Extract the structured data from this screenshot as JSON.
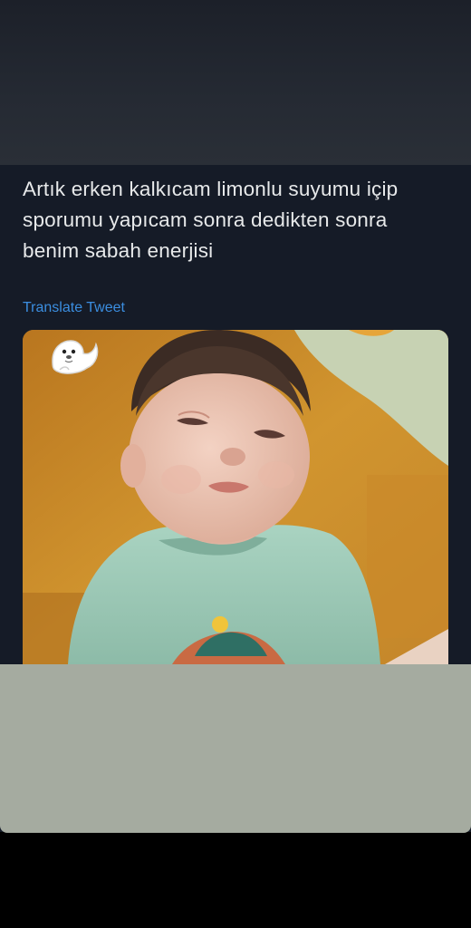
{
  "tweet": {
    "text": "Artık erken kalkıcam limonlu suyumu içip sporumu yapıcam sonra dedikten sonra benim sabah enerjisi",
    "translate_label": "Translate Tweet"
  },
  "media": {
    "icon": "seal-sticker-icon",
    "description_colors": {
      "background": "#c88a2a",
      "shirt": "#9cc7b4"
    }
  },
  "colors": {
    "card_background": "#151b27",
    "text": "#e7e9ea",
    "link": "#3b8ee0",
    "bottom_panel": "#a5aba0"
  }
}
